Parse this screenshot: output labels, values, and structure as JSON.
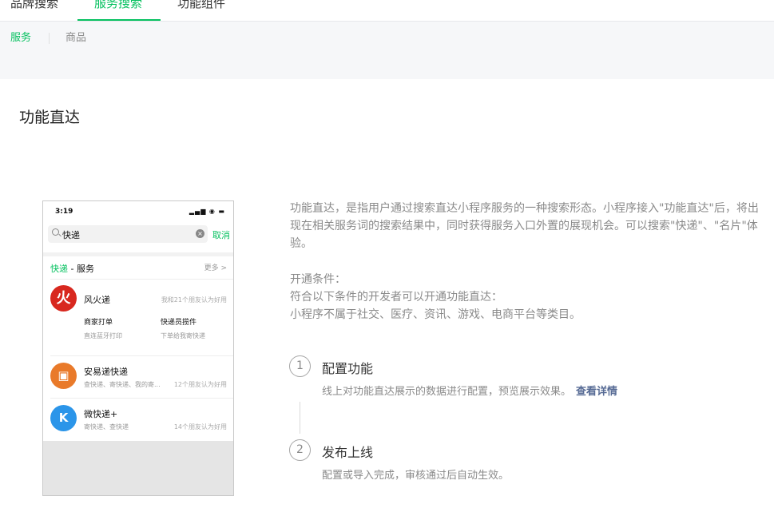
{
  "top_tabs": [
    "品牌搜索",
    "服务搜索",
    "功能组件"
  ],
  "sub_tabs": [
    "服务",
    "商品"
  ],
  "page_title": "功能直达",
  "phone": {
    "time": "3:19",
    "status_icons": "▂▄▆ ◉ ▬",
    "search_query": "快递",
    "cancel": "取消",
    "section_keyword": "快递",
    "section_suffix": " - 服务",
    "more": "更多 >",
    "results": [
      {
        "name": "风火递",
        "logo_text": "火",
        "friends": "我和21个朋友认为好用",
        "services": [
          {
            "title": "商家打单",
            "desc": "直连蓝牙打印"
          },
          {
            "title": "快递员揽件",
            "desc": "下单给我寄快递"
          }
        ]
      },
      {
        "name": "安易递快递",
        "logo_text": "▣",
        "desc": "查快递、寄快递、我的寄...",
        "friends": "12个朋友认为好用"
      },
      {
        "name": "微快递+",
        "logo_text": "K",
        "desc": "寄快递、查快递",
        "friends": "14个朋友认为好用"
      }
    ]
  },
  "description": "功能直达，是指用户通过搜索直达小程序服务的一种搜索形态。小程序接入\"功能直达\"后，将出现在相关服务词的搜索结果中，同时获得服务入口外置的展现机会。可以搜索\"快递\"、\"名片\"体验。",
  "conditions": {
    "heading": "开通条件：",
    "line1": "符合以下条件的开发者可以开通功能直达：",
    "line2": "小程序不属于社交、医疗、资讯、游戏、电商平台等类目。"
  },
  "steps": [
    {
      "num": "1",
      "title": "配置功能",
      "desc": "线上对功能直达展示的数据进行配置，预览展示效果。",
      "link": "查看详情"
    },
    {
      "num": "2",
      "title": "发布上线",
      "desc": "配置或导入完成，审核通过后自动生效。"
    }
  ],
  "colors": {
    "accent": "#07c160",
    "link": "#576b95"
  }
}
